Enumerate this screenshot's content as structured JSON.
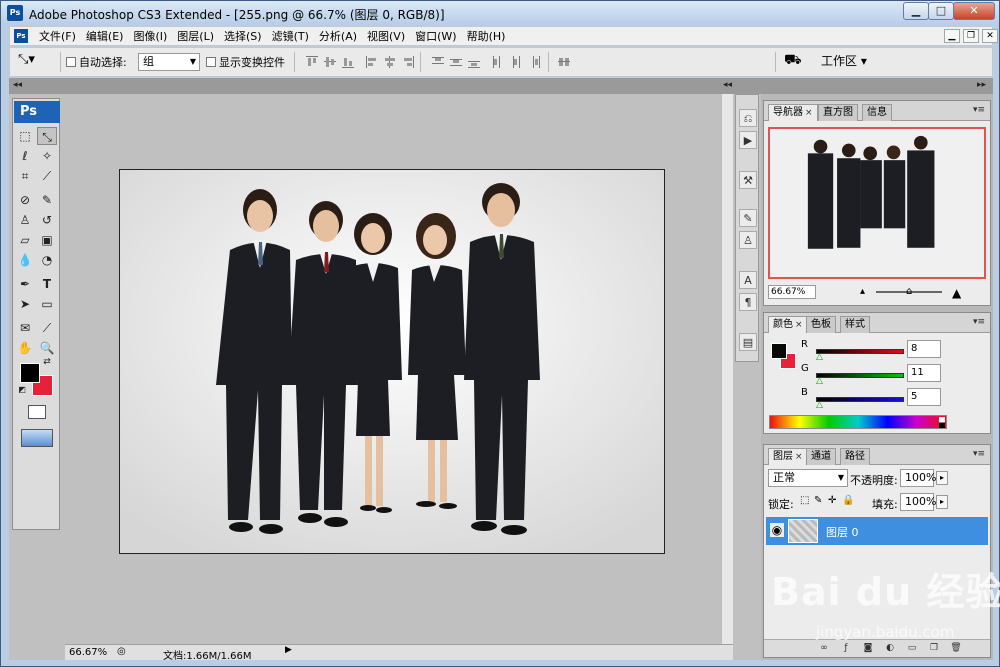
{
  "window": {
    "app_badge": "Ps",
    "title": "Adobe Photoshop CS3 Extended - [255.png @ 66.7% (图层 0, RGB/8)]",
    "min_label": "▁",
    "max_label": "□",
    "close_label": "✕"
  },
  "menubar": {
    "badge": "Ps",
    "items": [
      "文件(F)",
      "编辑(E)",
      "图像(I)",
      "图层(L)",
      "选择(S)",
      "滤镜(T)",
      "分析(A)",
      "视图(V)",
      "窗口(W)",
      "帮助(H)"
    ],
    "doc_min": "▁",
    "doc_restore": "❐",
    "doc_close": "✕"
  },
  "options": {
    "auto_select_label": "自动选择:",
    "auto_select_value": "组",
    "show_transform_label": "显示变换控件",
    "workspace_label": "工作区 ▾"
  },
  "tools": {
    "badge": "Ps"
  },
  "status": {
    "zoom": "66.67%",
    "doc_size": "文档:1.66M/1.66M",
    "arrow": "▶"
  },
  "navigator": {
    "tabs": [
      "导航器",
      "直方图",
      "信息"
    ],
    "zoom": "66.67%"
  },
  "color": {
    "tabs": [
      "颜色",
      "色板",
      "样式"
    ],
    "channels": [
      {
        "label": "R",
        "value": "8",
        "gradient": "linear-gradient(90deg,#000,#e01010)"
      },
      {
        "label": "G",
        "value": "11",
        "gradient": "linear-gradient(90deg,#000,#10c010)"
      },
      {
        "label": "B",
        "value": "5",
        "gradient": "linear-gradient(90deg,#000,#1010e0)"
      }
    ],
    "fg": "#080b05",
    "bg": "#e8213a"
  },
  "layers": {
    "tabs": [
      "图层",
      "通道",
      "路径"
    ],
    "blend_mode": "正常",
    "opacity_label": "不透明度:",
    "opacity_value": "100%",
    "lock_label": "锁定:",
    "fill_label": "填充:",
    "fill_value": "100%",
    "layer_name": "图层 0"
  },
  "watermark": {
    "main": "Bai du 经验",
    "sub": "jingyan.baidu.com"
  }
}
